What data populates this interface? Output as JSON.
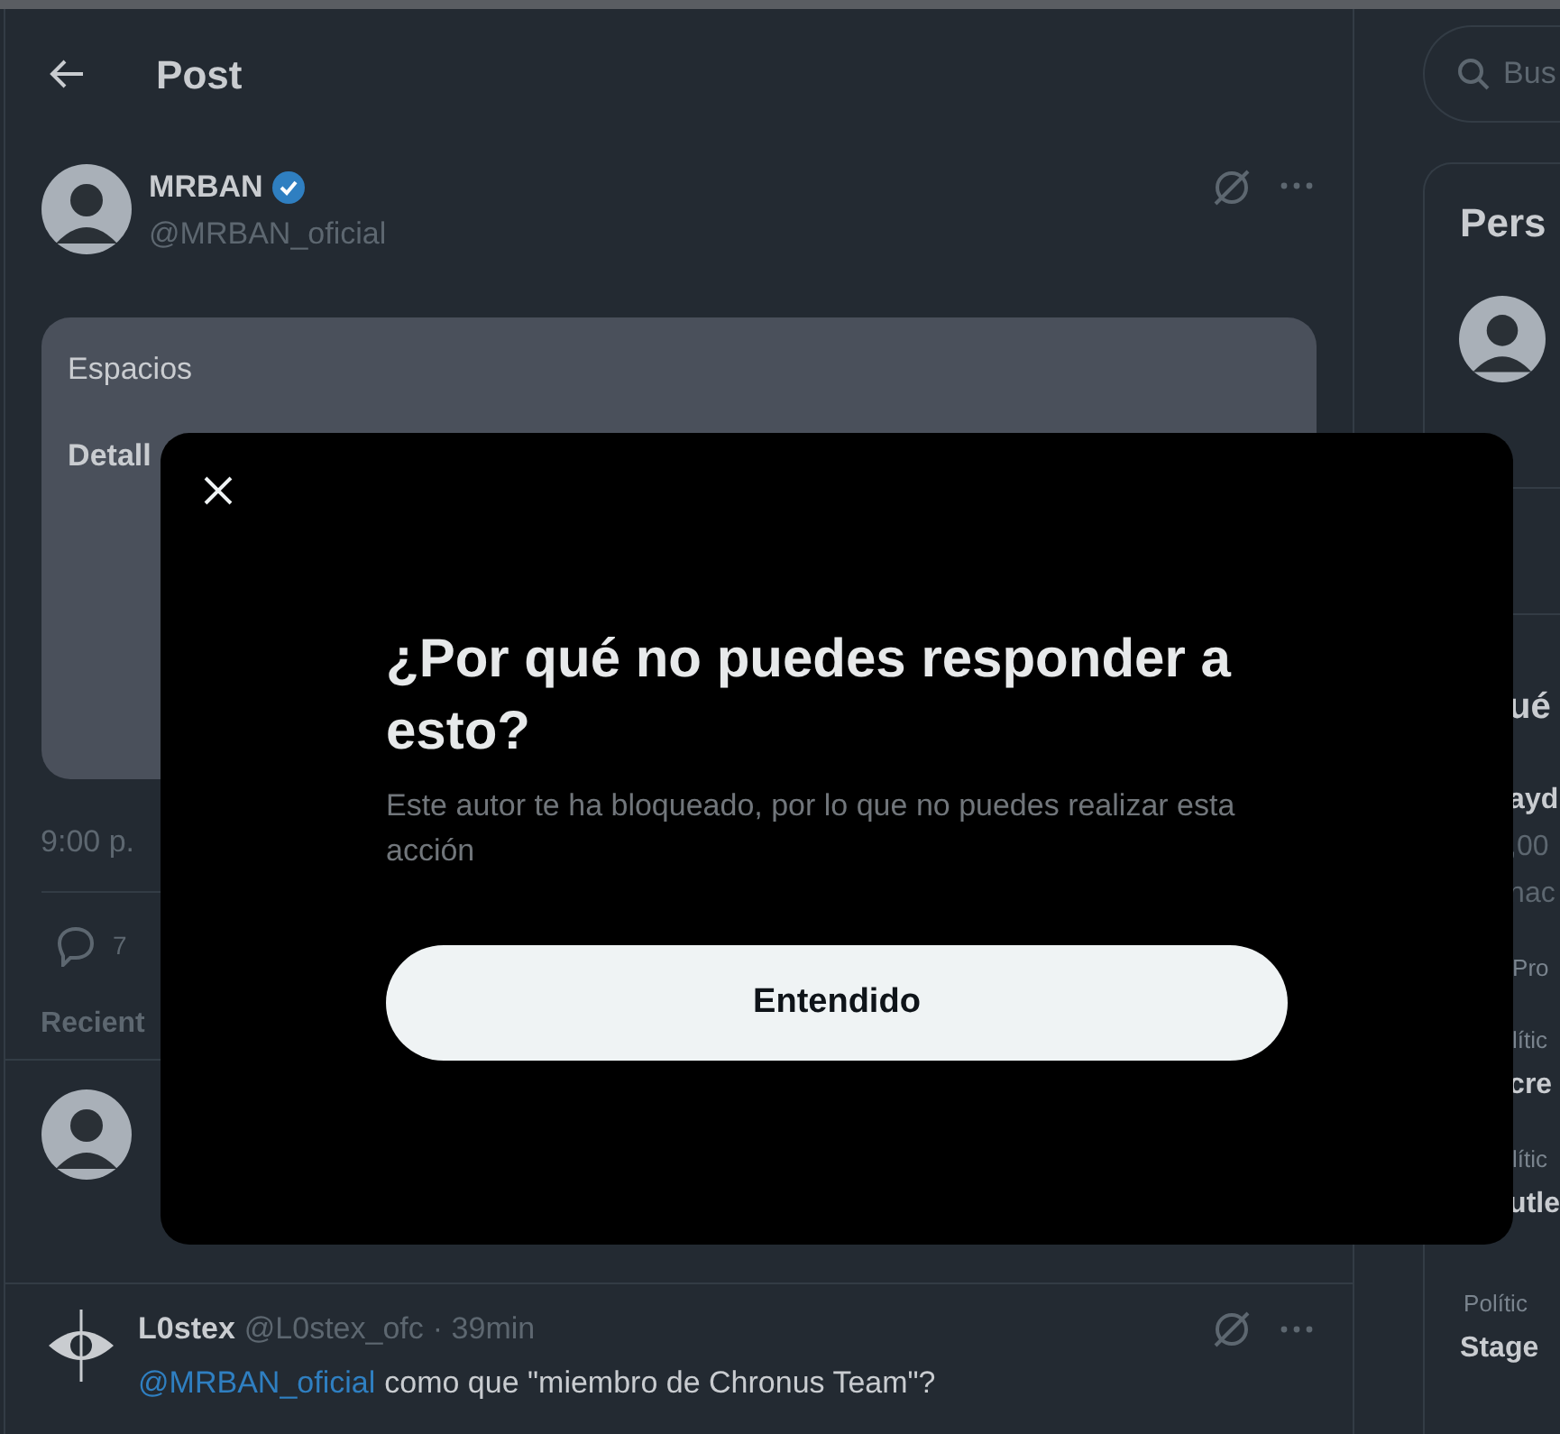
{
  "header": {
    "title": "Post"
  },
  "post": {
    "author": {
      "name": "MRBAN",
      "verified": true,
      "handle": "@MRBAN_oficial"
    },
    "space_card": {
      "label": "Espacios",
      "title": "Detall"
    },
    "time": "9:00 p.",
    "replies": "7",
    "sort_label": "Recient"
  },
  "reply": {
    "name": "L0stex",
    "handle": "@L0stex_ofc",
    "time": "· 39min",
    "mention": "@MRBAN_oficial",
    "text": "como que \"miembro de Chronus Team\"?"
  },
  "sidebar": {
    "search": {
      "placeholder": "Bus"
    },
    "card_title": "Pers",
    "partial_items": [
      {
        "text": "ué",
        "kind": "heading"
      },
      {
        "text": "ayd",
        "kind": "title"
      },
      {
        "text": ",00",
        "kind": "meta"
      },
      {
        "text": "nac",
        "kind": "meta"
      },
      {
        "text": "Pro",
        "kind": "small"
      },
      {
        "text": "lític",
        "kind": "small"
      },
      {
        "text": "cre",
        "kind": "title"
      },
      {
        "text": "lític",
        "kind": "small"
      },
      {
        "text": "utle",
        "kind": "title"
      }
    ],
    "items": [
      {
        "text": "Polític",
        "kind": "small"
      },
      {
        "text": "Stage",
        "kind": "title"
      }
    ]
  },
  "dialog": {
    "title": "¿Por qué no puedes responder a esto?",
    "message": "Este autor te ha bloqueado, por lo que no puedes realizar esta acción",
    "button": "Entendido"
  }
}
